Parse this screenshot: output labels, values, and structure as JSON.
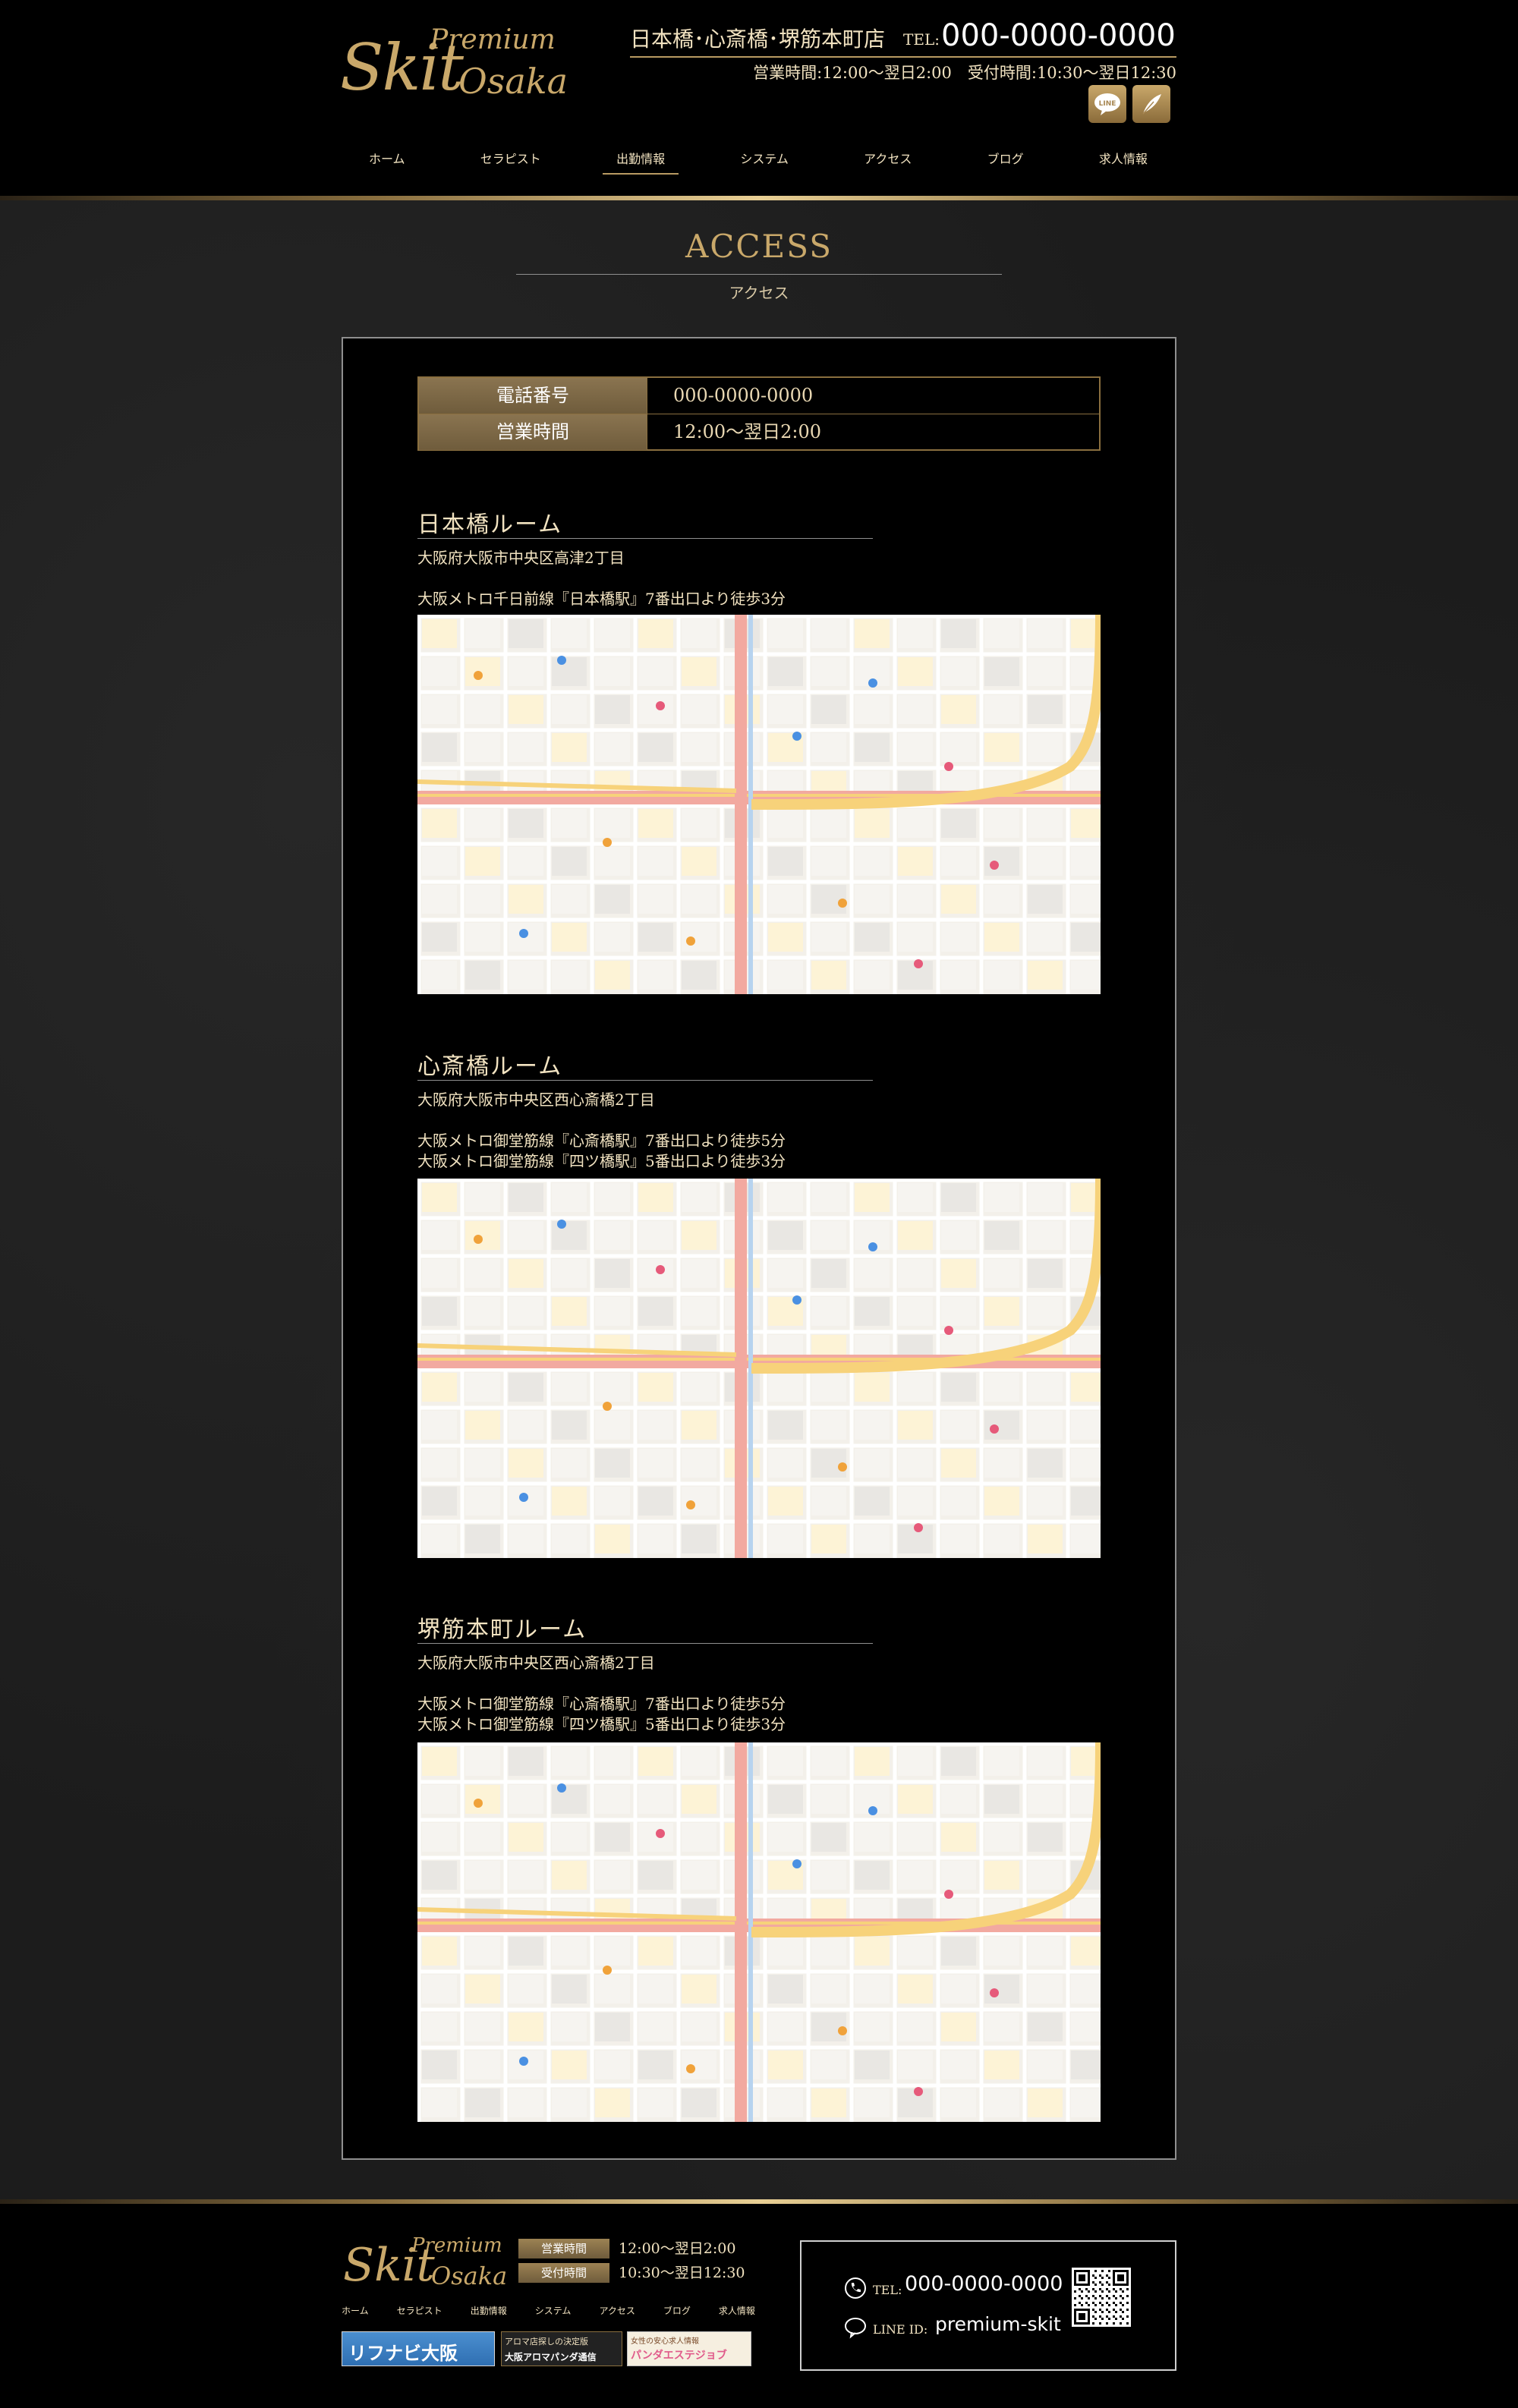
{
  "header": {
    "logo_premium": "Premium",
    "logo_skit": "Skit",
    "logo_osaka": "Osaka",
    "shop_name": "日本橋･心斎橋･堺筋本町店",
    "tel_label": "TEL:",
    "tel": "000-0000-0000",
    "hours": "営業時間:12:00～翌日2:00　受付時間:10:30～翌日12:30",
    "line_icon_label": "LINE"
  },
  "nav": {
    "items": [
      {
        "label": "ホーム"
      },
      {
        "label": "セラピスト"
      },
      {
        "label": "出勤情報"
      },
      {
        "label": "システム"
      },
      {
        "label": "アクセス"
      },
      {
        "label": "ブログ"
      },
      {
        "label": "求人情報"
      }
    ]
  },
  "page": {
    "title": "ACCESS",
    "subtitle": "アクセス"
  },
  "info": {
    "rows": [
      {
        "label": "電話番号",
        "value": "000-0000-0000"
      },
      {
        "label": "営業時間",
        "value": "12:00～翌日2:00"
      }
    ]
  },
  "rooms": [
    {
      "name": "日本橋ルーム",
      "address": "大阪府大阪市中央区高津2丁目",
      "access": [
        "大阪メトロ千日前線『日本橋駅』7番出口より徒歩3分"
      ]
    },
    {
      "name": "心斎橋ルーム",
      "address": "大阪府大阪市中央区西心斎橋2丁目",
      "access": [
        "大阪メトロ御堂筋線『心斎橋駅』7番出口より徒歩5分",
        "大阪メトロ御堂筋線『四ツ橋駅』5番出口より徒歩3分"
      ]
    },
    {
      "name": "堺筋本町ルーム",
      "address": "大阪府大阪市中央区西心斎橋2丁目",
      "access": [
        "大阪メトロ御堂筋線『心斎橋駅』7番出口より徒歩5分",
        "大阪メトロ御堂筋線『四ツ橋駅』5番出口より徒歩3分"
      ]
    }
  ],
  "footer": {
    "hours": [
      {
        "label": "営業時間",
        "value": "12:00～翌日2:00"
      },
      {
        "label": "受付時間",
        "value": "10:30～翌日12:30"
      }
    ],
    "nav": [
      "ホーム",
      "セラピスト",
      "出勤情報",
      "システム",
      "アクセス",
      "ブログ",
      "求人情報"
    ],
    "banners": {
      "b1": "リフナビ大阪",
      "b2_line1": "アロマ店探しの決定版",
      "b2_line2": "大阪アロマパンダ通信",
      "b3_line1": "女性の安心求人情報",
      "b3_line2": "パンダエステジョブ"
    },
    "tel_label": "TEL:",
    "tel": "000-0000-0000",
    "line_label": "LINE ID:",
    "line_id": "premium-skit"
  },
  "colors": {
    "gold": "#c9a86a",
    "background": "#1c1c1c",
    "panel": "#000000"
  }
}
